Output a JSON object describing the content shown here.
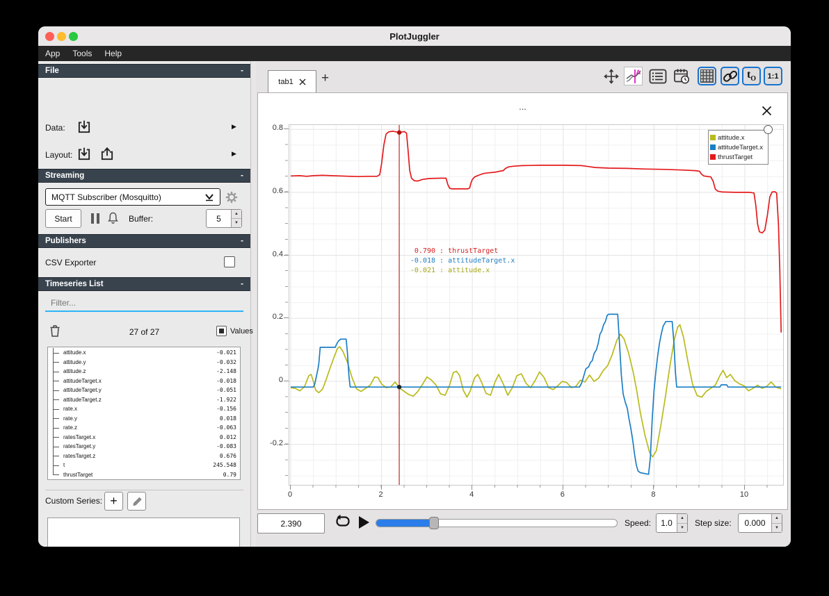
{
  "window": {
    "title": "PlotJuggler"
  },
  "menu": {
    "items": [
      "App",
      "Tools",
      "Help"
    ]
  },
  "sidebar": {
    "file": {
      "header": "File",
      "collapse": "-",
      "data_label": "Data:",
      "layout_label": "Layout:"
    },
    "streaming": {
      "header": "Streaming",
      "collapse": "-",
      "source": "MQTT Subscriber (Mosquitto)",
      "start": "Start",
      "buffer_label": "Buffer:",
      "buffer_value": "5"
    },
    "publishers": {
      "header": "Publishers",
      "collapse": "-",
      "csv": "CSV Exporter"
    },
    "timeseries": {
      "header": "Timeseries List",
      "collapse": "-",
      "filter_placeholder": "Filter...",
      "count": "27 of 27",
      "values_label": "Values",
      "items": [
        {
          "name": "attitude.x",
          "value": "-0.021"
        },
        {
          "name": "attitude.y",
          "value": "-0.032"
        },
        {
          "name": "attitude.z",
          "value": "-2.148"
        },
        {
          "name": "attitudeTarget.x",
          "value": "-0.018"
        },
        {
          "name": "attitudeTarget.y",
          "value": "-0.051"
        },
        {
          "name": "attitudeTarget.z",
          "value": "-1.922"
        },
        {
          "name": "rate.x",
          "value": "-0.156"
        },
        {
          "name": "rate.y",
          "value": "0.018"
        },
        {
          "name": "rate.z",
          "value": "-0.063"
        },
        {
          "name": "ratesTarget.x",
          "value": "0.012"
        },
        {
          "name": "ratesTarget.y",
          "value": "-0.083"
        },
        {
          "name": "ratesTarget.z",
          "value": "0.676"
        },
        {
          "name": "t",
          "value": "245.548"
        },
        {
          "name": "thrustTarget",
          "value": "0.79"
        }
      ]
    },
    "custom_series": {
      "label": "Custom Series:",
      "add": "+"
    }
  },
  "tabbar": {
    "active_tab": "tab1",
    "add": "+"
  },
  "plot": {
    "title": "...",
    "legend": [
      {
        "label": "attitude.x",
        "color": "#b9ba1c"
      },
      {
        "label": "attitudeTarget.x",
        "color": "#1c7ec5"
      },
      {
        "label": "thrustTarget",
        "color": "#e41a1c"
      }
    ],
    "tooltip": [
      {
        "value": " 0.790",
        "name": "thrustTarget",
        "color": "#d62021"
      },
      {
        "value": "-0.018",
        "name": "attitudeTarget.x",
        "color": "#1f7dc2"
      },
      {
        "value": "-0.021",
        "name": "attitude.x",
        "color": "#a6a714"
      }
    ]
  },
  "chart_data": {
    "type": "line",
    "title": "...",
    "xlabel": "",
    "ylabel": "",
    "xlim": [
      0,
      10.84
    ],
    "ylim": [
      -0.329,
      0.814
    ],
    "x_ticks": [
      0,
      2,
      4,
      6,
      8,
      10
    ],
    "y_ticks": [
      0.8,
      0.6,
      0.4,
      0.2,
      0,
      -0.2
    ],
    "grid": true,
    "legend_position": "top-right",
    "tracker": {
      "x": 2.39,
      "points": [
        {
          "y": 0.79,
          "color": "#b40f0f"
        },
        {
          "y": -0.018,
          "color": "#20262b"
        }
      ]
    },
    "series": [
      {
        "name": "attitude.x",
        "color": "#b9ba1c",
        "points": [
          [
            0,
            -0.02
          ],
          [
            0.1,
            -0.022
          ],
          [
            0.2,
            -0.03
          ],
          [
            0.3,
            -0.018
          ],
          [
            0.4,
            0.018
          ],
          [
            0.45,
            0.022
          ],
          [
            0.5,
            0
          ],
          [
            0.55,
            -0.028
          ],
          [
            0.62,
            -0.036
          ],
          [
            0.7,
            -0.025
          ],
          [
            0.78,
            0.005
          ],
          [
            0.85,
            0.035
          ],
          [
            0.95,
            0.075
          ],
          [
            1.03,
            0.105
          ],
          [
            1.08,
            0.11
          ],
          [
            1.15,
            0.095
          ],
          [
            1.25,
            0.06
          ],
          [
            1.35,
            0.012
          ],
          [
            1.45,
            -0.024
          ],
          [
            1.55,
            -0.032
          ],
          [
            1.65,
            -0.022
          ],
          [
            1.75,
            -0.012
          ],
          [
            1.85,
            0.014
          ],
          [
            1.92,
            0.012
          ],
          [
            2,
            -0.008
          ],
          [
            2.1,
            -0.02
          ],
          [
            2.2,
            -0.018
          ],
          [
            2.3,
            -0.002
          ],
          [
            2.39,
            -0.021
          ],
          [
            2.5,
            -0.032
          ],
          [
            2.6,
            -0.042
          ],
          [
            2.7,
            -0.047
          ],
          [
            2.8,
            -0.032
          ],
          [
            2.9,
            -0.01
          ],
          [
            3,
            0.014
          ],
          [
            3.1,
            0.004
          ],
          [
            3.2,
            -0.012
          ],
          [
            3.3,
            -0.04
          ],
          [
            3.4,
            -0.044
          ],
          [
            3.5,
            -0.012
          ],
          [
            3.58,
            0.028
          ],
          [
            3.65,
            0.032
          ],
          [
            3.72,
            0.018
          ],
          [
            3.8,
            -0.028
          ],
          [
            3.88,
            -0.05
          ],
          [
            3.95,
            -0.032
          ],
          [
            4.05,
            0.012
          ],
          [
            4.12,
            0.022
          ],
          [
            4.2,
            -0.002
          ],
          [
            4.3,
            -0.038
          ],
          [
            4.4,
            -0.044
          ],
          [
            4.5,
            -0.002
          ],
          [
            4.58,
            0.022
          ],
          [
            4.68,
            -0.008
          ],
          [
            4.78,
            -0.044
          ],
          [
            4.88,
            -0.02
          ],
          [
            4.98,
            0.018
          ],
          [
            5.08,
            0.024
          ],
          [
            5.18,
            -0.006
          ],
          [
            5.28,
            -0.02
          ],
          [
            5.38,
            0.002
          ],
          [
            5.48,
            0.03
          ],
          [
            5.58,
            0.012
          ],
          [
            5.68,
            -0.02
          ],
          [
            5.78,
            -0.026
          ],
          [
            5.88,
            -0.014
          ],
          [
            5.98,
            0
          ],
          [
            6.08,
            -0.004
          ],
          [
            6.18,
            -0.02
          ],
          [
            6.28,
            -0.016
          ],
          [
            6.38,
            0.004
          ],
          [
            6.48,
            -0.002
          ],
          [
            6.58,
            0.02
          ],
          [
            6.68,
            0
          ],
          [
            6.78,
            0.01
          ],
          [
            6.88,
            0.034
          ],
          [
            6.98,
            0.05
          ],
          [
            7.08,
            0.085
          ],
          [
            7.18,
            0.13
          ],
          [
            7.26,
            0.15
          ],
          [
            7.34,
            0.135
          ],
          [
            7.44,
            0.09
          ],
          [
            7.54,
            0.03
          ],
          [
            7.62,
            -0.03
          ],
          [
            7.7,
            -0.1
          ],
          [
            7.8,
            -0.17
          ],
          [
            7.9,
            -0.225
          ],
          [
            7.97,
            -0.24
          ],
          [
            8.05,
            -0.22
          ],
          [
            8.15,
            -0.14
          ],
          [
            8.25,
            -0.05
          ],
          [
            8.35,
            0.05
          ],
          [
            8.45,
            0.135
          ],
          [
            8.52,
            0.172
          ],
          [
            8.57,
            0.18
          ],
          [
            8.65,
            0.14
          ],
          [
            8.75,
            0.06
          ],
          [
            8.85,
            -0.01
          ],
          [
            8.95,
            -0.045
          ],
          [
            9.05,
            -0.05
          ],
          [
            9.15,
            -0.032
          ],
          [
            9.25,
            -0.022
          ],
          [
            9.35,
            -0.012
          ],
          [
            9.45,
            0.018
          ],
          [
            9.52,
            0.035
          ],
          [
            9.6,
            0.012
          ],
          [
            9.68,
            0.022
          ],
          [
            9.78,
            0.002
          ],
          [
            9.88,
            -0.008
          ],
          [
            9.98,
            -0.014
          ],
          [
            10.08,
            -0.03
          ],
          [
            10.18,
            -0.022
          ],
          [
            10.28,
            -0.012
          ],
          [
            10.38,
            -0.022
          ],
          [
            10.48,
            -0.016
          ],
          [
            10.58,
            -0.002
          ],
          [
            10.68,
            -0.018
          ],
          [
            10.8,
            -0.024
          ]
        ]
      },
      {
        "name": "attitudeTarget.x",
        "color": "#1c7ec5",
        "points": [
          [
            0,
            -0.018
          ],
          [
            0.5,
            -0.018
          ],
          [
            0.53,
            -0.008
          ],
          [
            0.56,
            0.012
          ],
          [
            0.6,
            0.04
          ],
          [
            0.62,
            0.058
          ],
          [
            0.65,
            0.108
          ],
          [
            0.98,
            0.108
          ],
          [
            1.01,
            0.118
          ],
          [
            1.05,
            0.128
          ],
          [
            1.1,
            0.134
          ],
          [
            1.22,
            0.134
          ],
          [
            1.25,
            0.09
          ],
          [
            1.28,
            0.02
          ],
          [
            1.31,
            -0.018
          ],
          [
            6.36,
            -0.018
          ],
          [
            6.41,
            -0.004
          ],
          [
            6.46,
            0.02
          ],
          [
            6.5,
            0.04
          ],
          [
            6.56,
            0.046
          ],
          [
            6.6,
            0.06
          ],
          [
            6.64,
            0.066
          ],
          [
            6.68,
            0.088
          ],
          [
            6.73,
            0.1
          ],
          [
            6.77,
            0.12
          ],
          [
            6.81,
            0.15
          ],
          [
            6.85,
            0.16
          ],
          [
            6.89,
            0.18
          ],
          [
            6.93,
            0.19
          ],
          [
            6.97,
            0.21
          ],
          [
            7,
            0.213
          ],
          [
            7.2,
            0.213
          ],
          [
            7.24,
            0.12
          ],
          [
            7.28,
            0.02
          ],
          [
            7.32,
            -0.04
          ],
          [
            7.37,
            -0.068
          ],
          [
            7.41,
            -0.085
          ],
          [
            7.45,
            -0.12
          ],
          [
            7.49,
            -0.15
          ],
          [
            7.53,
            -0.185
          ],
          [
            7.57,
            -0.23
          ],
          [
            7.61,
            -0.265
          ],
          [
            7.65,
            -0.285
          ],
          [
            7.7,
            -0.29
          ],
          [
            7.88,
            -0.295
          ],
          [
            7.92,
            -0.24
          ],
          [
            7.96,
            -0.12
          ],
          [
            8,
            -0.03
          ],
          [
            8.04,
            0.03
          ],
          [
            8.08,
            0.08
          ],
          [
            8.12,
            0.12
          ],
          [
            8.16,
            0.15
          ],
          [
            8.2,
            0.175
          ],
          [
            8.26,
            0.19
          ],
          [
            8.4,
            0.19
          ],
          [
            8.44,
            0.12
          ],
          [
            8.47,
            0.03
          ],
          [
            8.5,
            -0.018
          ],
          [
            9.45,
            -0.018
          ],
          [
            9.48,
            -0.011
          ],
          [
            9.6,
            -0.011
          ],
          [
            9.63,
            -0.018
          ],
          [
            10.8,
            -0.018
          ]
        ]
      },
      {
        "name": "thrustTarget",
        "color": "#e41a1c",
        "points": [
          [
            0,
            0.652
          ],
          [
            0.2,
            0.653
          ],
          [
            0.35,
            0.651
          ],
          [
            0.5,
            0.653
          ],
          [
            0.7,
            0.654
          ],
          [
            0.9,
            0.653
          ],
          [
            1.1,
            0.652
          ],
          [
            1.3,
            0.651
          ],
          [
            1.5,
            0.65
          ],
          [
            1.7,
            0.651
          ],
          [
            1.9,
            0.651
          ],
          [
            1.96,
            0.656
          ],
          [
            2,
            0.69
          ],
          [
            2.05,
            0.75
          ],
          [
            2.1,
            0.785
          ],
          [
            2.16,
            0.792
          ],
          [
            2.25,
            0.794
          ],
          [
            2.39,
            0.79
          ],
          [
            2.5,
            0.793
          ],
          [
            2.55,
            0.788
          ],
          [
            2.58,
            0.74
          ],
          [
            2.62,
            0.67
          ],
          [
            2.66,
            0.645
          ],
          [
            2.72,
            0.637
          ],
          [
            2.8,
            0.636
          ],
          [
            2.9,
            0.641
          ],
          [
            3,
            0.643
          ],
          [
            3.1,
            0.644
          ],
          [
            3.3,
            0.645
          ],
          [
            3.42,
            0.645
          ],
          [
            3.46,
            0.625
          ],
          [
            3.5,
            0.613
          ],
          [
            3.55,
            0.611
          ],
          [
            3.9,
            0.611
          ],
          [
            3.94,
            0.614
          ],
          [
            3.97,
            0.63
          ],
          [
            4,
            0.641
          ],
          [
            4.05,
            0.649
          ],
          [
            4.1,
            0.652
          ],
          [
            4.15,
            0.655
          ],
          [
            4.25,
            0.66
          ],
          [
            4.35,
            0.662
          ],
          [
            4.5,
            0.664
          ],
          [
            4.6,
            0.667
          ],
          [
            4.68,
            0.669
          ],
          [
            4.73,
            0.676
          ],
          [
            4.8,
            0.681
          ],
          [
            4.9,
            0.683
          ],
          [
            5.1,
            0.685
          ],
          [
            5.5,
            0.686
          ],
          [
            6,
            0.686
          ],
          [
            6.4,
            0.685
          ],
          [
            6.55,
            0.682
          ],
          [
            6.7,
            0.679
          ],
          [
            7,
            0.677
          ],
          [
            7.4,
            0.676
          ],
          [
            7.8,
            0.674
          ],
          [
            8.2,
            0.673
          ],
          [
            8.6,
            0.671
          ],
          [
            8.9,
            0.669
          ],
          [
            9,
            0.667
          ],
          [
            9.05,
            0.657
          ],
          [
            9.1,
            0.652
          ],
          [
            9.25,
            0.649
          ],
          [
            9.3,
            0.636
          ],
          [
            9.35,
            0.61
          ],
          [
            9.4,
            0.604
          ],
          [
            9.5,
            0.601
          ],
          [
            9.8,
            0.6
          ],
          [
            10.1,
            0.6
          ],
          [
            10.2,
            0.598
          ],
          [
            10.24,
            0.56
          ],
          [
            10.28,
            0.5
          ],
          [
            10.32,
            0.475
          ],
          [
            10.38,
            0.471
          ],
          [
            10.44,
            0.48
          ],
          [
            10.5,
            0.53
          ],
          [
            10.55,
            0.585
          ],
          [
            10.6,
            0.601
          ],
          [
            10.66,
            0.602
          ],
          [
            10.7,
            0.598
          ],
          [
            10.74,
            0.5
          ],
          [
            10.77,
            0.35
          ],
          [
            10.8,
            0.155
          ]
        ]
      }
    ]
  },
  "transport": {
    "time": "2.390",
    "speed_label": "Speed:",
    "speed": "1.0",
    "step_label": "Step size:",
    "step": "0.000"
  }
}
